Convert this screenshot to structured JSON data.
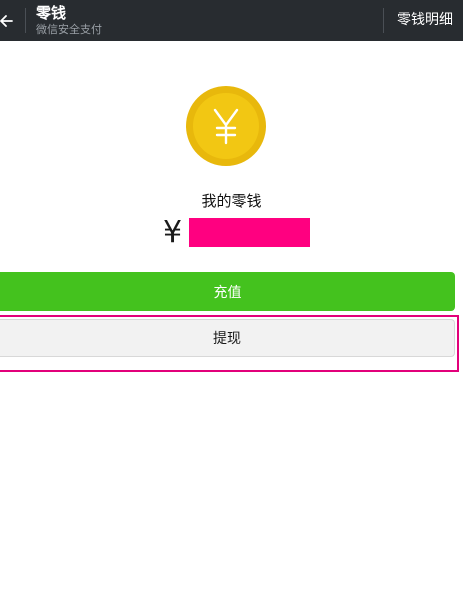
{
  "header": {
    "title": "零钱",
    "subtitle": "微信安全支付",
    "action_label": "零钱明细"
  },
  "balance": {
    "label": "我的零钱",
    "currency_symbol": "¥",
    "amount": ""
  },
  "buttons": {
    "recharge_label": "充值",
    "withdraw_label": "提现"
  },
  "icons": {
    "back": "arrow-left-icon",
    "coin": "yuan-coin-icon"
  },
  "colors": {
    "header_bg": "#282c30",
    "coin_outer": "#e8b80c",
    "coin_inner": "#f2c713",
    "recharge_green": "#44c21e",
    "redaction": "#ff0080",
    "highlight_border": "#e2007a"
  }
}
